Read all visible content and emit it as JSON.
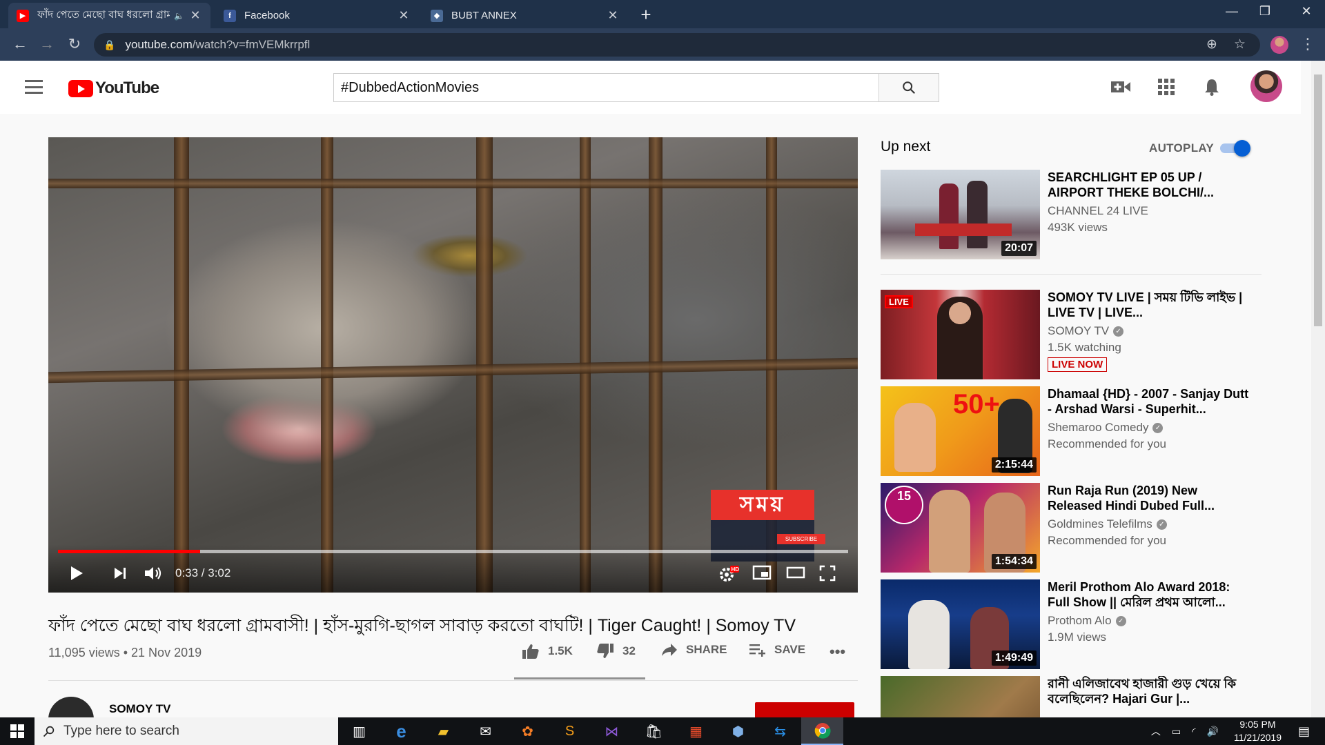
{
  "browser": {
    "tabs": [
      {
        "title": "ফাঁদ পেতে মেছো বাঘ ধরলো গ্রামবাসী",
        "favicon": "youtube-icon",
        "active": true
      },
      {
        "title": "Facebook",
        "favicon": "facebook-icon",
        "active": false
      },
      {
        "title": "BUBT ANNEX",
        "favicon": "web-icon",
        "active": false
      }
    ],
    "url_domain": "youtube.com",
    "url_path": "/watch?v=fmVEMkrrpfl"
  },
  "youtube": {
    "logo_text": "YouTube",
    "search_value": "#DubbedActionMovies",
    "search_placeholder": "Search"
  },
  "video": {
    "title": "ফাঁদ পেতে মেছো বাঘ ধরলো গ্রামবাসী! | হাঁস-মুরগি-ছাগল সাবাড় করতো বাঘটি! | Tiger Caught! | Somoy TV",
    "views_date": "11,095 views • 21 Nov 2019",
    "current_time": "0:33",
    "duration": "3:02",
    "time_text": "0:33 / 3:02",
    "progress_fraction": 0.18,
    "likes": "1.5K",
    "dislikes": "32",
    "share_label": "SHARE",
    "save_label": "SAVE",
    "channel_name": "SOMOY TV",
    "watermark_text": "সময়",
    "watermark_subscribe": "SUBSCRIBE"
  },
  "sidebar": {
    "up_next_label": "Up next",
    "autoplay_label": "AUTOPLAY",
    "autoplay_on": true,
    "items": [
      {
        "title": "SEARCHLIGHT EP 05 UP / AIRPORT THEKE BOLCHI/...",
        "channel": "CHANNEL 24 LIVE",
        "verified": false,
        "meta": "493K views",
        "duration": "20:07"
      },
      {
        "title": "SOMOY TV LIVE | সময় টিভি লাইভ | LIVE TV | LIVE...",
        "channel": "SOMOY TV",
        "verified": true,
        "meta": "1.5K watching",
        "badge": "LIVE NOW",
        "thumb_badge": "LIVE"
      },
      {
        "title": "Dhamaal {HD} - 2007 - Sanjay Dutt - Arshad Warsi - Superhit...",
        "channel": "Shemaroo Comedy",
        "verified": true,
        "meta": "Recommended for you",
        "duration": "2:15:44"
      },
      {
        "title": "Run Raja Run (2019) New Released Hindi Dubed Full...",
        "channel": "Goldmines Telefilms",
        "verified": true,
        "meta": "Recommended for you",
        "duration": "1:54:34"
      },
      {
        "title": "Meril Prothom Alo Award 2018: Full Show || মেরিল প্রথম আলো...",
        "channel": "Prothom Alo",
        "verified": true,
        "meta": "1.9M views",
        "duration": "1:49:49"
      },
      {
        "title": "রানী এলিজাবেথ হাজারী গুড় খেয়ে কি বলেছিলেন? Hajari Gur |...",
        "channel": "",
        "verified": false,
        "meta": ""
      }
    ]
  },
  "taskbar": {
    "search_placeholder": "Type here to search",
    "time": "9:05 PM",
    "date": "11/21/2019"
  },
  "colors": {
    "accent_red": "#ff0000",
    "chrome_frame": "#1f3149",
    "link_blue": "#065fd4"
  }
}
